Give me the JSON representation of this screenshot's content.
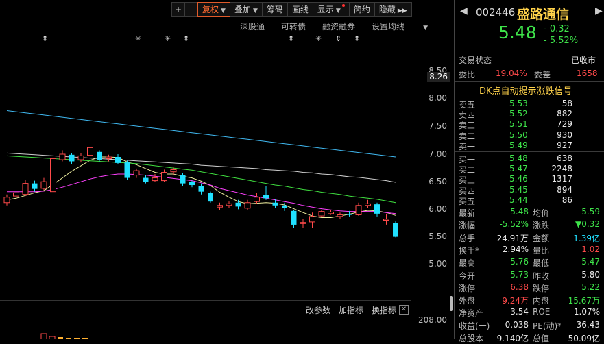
{
  "toolbar": {
    "plus": "+",
    "minus": "—",
    "fuquan": "复权",
    "diejia": "叠加",
    "chouma": "筹码",
    "huaxian": "画线",
    "xianshi": "显示",
    "jianyue": "简约",
    "yincang": "隐藏",
    "more": "▶▶"
  },
  "subbar": {
    "shengutong": "深股通",
    "kezhuanzhai": "可转债",
    "rongzirongquan": "融资融券",
    "shezhi_junxian": "设置均线"
  },
  "yaxis": {
    "labels": [
      "8.50",
      "8.00",
      "7.50",
      "7.00",
      "6.50",
      "6.00",
      "5.50",
      "5.00"
    ],
    "current": "8.26",
    "volume": "208.00"
  },
  "bottom_tabs": {
    "gaicanshu": "改参数",
    "jiazhibiao": "加指标",
    "huanzhibiao": "换指标"
  },
  "stock": {
    "code": "002446",
    "name": "盛路通信",
    "price": "5.48",
    "change": "- 0.32",
    "change_pct": "- 5.52%"
  },
  "status": {
    "label": "交易状态",
    "value": "已收市"
  },
  "weibi": {
    "label1": "委比",
    "value1": "19.04%",
    "label2": "委差",
    "value2": "1658"
  },
  "dk_signal": "DK点自动提示涨跌信号",
  "sells": [
    {
      "label": "卖五",
      "price": "5.53",
      "vol": "58"
    },
    {
      "label": "卖四",
      "price": "5.52",
      "vol": "882"
    },
    {
      "label": "卖三",
      "price": "5.51",
      "vol": "729"
    },
    {
      "label": "卖二",
      "price": "5.50",
      "vol": "930"
    },
    {
      "label": "卖一",
      "price": "5.49",
      "vol": "927"
    }
  ],
  "buys": [
    {
      "label": "买一",
      "price": "5.48",
      "vol": "638"
    },
    {
      "label": "买二",
      "price": "5.47",
      "vol": "2248"
    },
    {
      "label": "买三",
      "price": "5.46",
      "vol": "1317"
    },
    {
      "label": "买四",
      "price": "5.45",
      "vol": "894"
    },
    {
      "label": "买五",
      "price": "5.44",
      "vol": "86"
    }
  ],
  "stats": [
    {
      "l1": "最新",
      "v1": "5.48",
      "l2": "均价",
      "v2": "5.59"
    },
    {
      "l1": "涨幅",
      "v1": "-5.52%",
      "l2": "涨跌",
      "v2": "▼0.32"
    },
    {
      "l1": "总手",
      "v1": "24.91万",
      "l2": "金额",
      "v2": "1.39亿"
    },
    {
      "l1": "换手*",
      "v1": "2.94%",
      "l2": "量比",
      "v2": "1.02"
    },
    {
      "l1": "最高",
      "v1": "5.76",
      "l2": "最低",
      "v2": "5.47"
    },
    {
      "l1": "今开",
      "v1": "5.73",
      "l2": "昨收",
      "v2": "5.80"
    },
    {
      "l1": "涨停",
      "v1": "6.38",
      "l2": "跌停",
      "v2": "5.22"
    },
    {
      "l1": "外盘",
      "v1": "9.24万",
      "l2": "内盘",
      "v2": "15.67万"
    },
    {
      "l1": "净资产",
      "v1": "3.54",
      "l2": "ROE",
      "v2": "1.07%"
    },
    {
      "l1": "收益(一)",
      "v1": "0.038",
      "l2": "PE(动)*",
      "v2": "36.43"
    },
    {
      "l1": "总股本",
      "v1": "9.140亿",
      "l2": "总值",
      "v2": "50.09亿"
    }
  ],
  "colors": {
    "up": "#ff4a4a",
    "down": "#3ee34a",
    "cyan": "#20e0ff",
    "accent": "#ff6a30",
    "title_yellow": "#ffd24a"
  },
  "chart_data": {
    "type": "candlestick",
    "ylim": [
      4.8,
      8.6
    ],
    "candles": [
      {
        "o": 6.1,
        "c": 6.2,
        "h": 6.25,
        "l": 6.05
      },
      {
        "o": 6.22,
        "c": 6.28,
        "h": 6.32,
        "l": 6.18
      },
      {
        "o": 6.25,
        "c": 6.45,
        "h": 6.52,
        "l": 6.22
      },
      {
        "o": 6.45,
        "c": 6.35,
        "h": 6.5,
        "l": 6.3
      },
      {
        "o": 6.36,
        "c": 6.48,
        "h": 6.55,
        "l": 6.33
      },
      {
        "o": 6.3,
        "c": 6.9,
        "h": 7.02,
        "l": 6.28
      },
      {
        "o": 6.88,
        "c": 6.98,
        "h": 7.05,
        "l": 6.85
      },
      {
        "o": 6.97,
        "c": 6.85,
        "h": 7.0,
        "l": 6.8
      },
      {
        "o": 6.88,
        "c": 6.95,
        "h": 7.0,
        "l": 6.83
      },
      {
        "o": 6.96,
        "c": 7.1,
        "h": 7.15,
        "l": 6.92
      },
      {
        "o": 7.02,
        "c": 6.88,
        "h": 7.05,
        "l": 6.85
      },
      {
        "o": 6.9,
        "c": 6.93,
        "h": 6.97,
        "l": 6.85
      },
      {
        "o": 6.93,
        "c": 6.82,
        "h": 6.98,
        "l": 6.8
      },
      {
        "o": 6.83,
        "c": 6.55,
        "h": 6.86,
        "l": 6.52
      },
      {
        "o": 6.6,
        "c": 6.68,
        "h": 6.72,
        "l": 6.55
      },
      {
        "o": 6.55,
        "c": 6.47,
        "h": 6.6,
        "l": 6.45
      },
      {
        "o": 6.5,
        "c": 6.55,
        "h": 6.62,
        "l": 6.48
      },
      {
        "o": 6.5,
        "c": 6.65,
        "h": 6.7,
        "l": 6.48
      },
      {
        "o": 6.66,
        "c": 6.7,
        "h": 6.74,
        "l": 6.6
      },
      {
        "o": 6.6,
        "c": 6.45,
        "h": 6.64,
        "l": 6.4
      },
      {
        "o": 6.47,
        "c": 6.42,
        "h": 6.5,
        "l": 6.38
      },
      {
        "o": 6.4,
        "c": 6.3,
        "h": 6.45,
        "l": 6.25
      },
      {
        "o": 6.28,
        "c": 6.12,
        "h": 6.3,
        "l": 6.1
      },
      {
        "o": 6.02,
        "c": 6.05,
        "h": 6.1,
        "l": 5.97
      },
      {
        "o": 6.05,
        "c": 6.08,
        "h": 6.12,
        "l": 6.01
      },
      {
        "o": 6.1,
        "c": 6.03,
        "h": 6.15,
        "l": 5.98
      },
      {
        "o": 6.0,
        "c": 6.1,
        "h": 6.15,
        "l": 5.97
      },
      {
        "o": 6.12,
        "c": 6.2,
        "h": 6.28,
        "l": 6.08
      },
      {
        "o": 6.24,
        "c": 6.18,
        "h": 6.4,
        "l": 6.15
      },
      {
        "o": 6.1,
        "c": 6.05,
        "h": 6.16,
        "l": 6.0
      },
      {
        "o": 6.05,
        "c": 6.0,
        "h": 6.1,
        "l": 5.95
      },
      {
        "o": 5.95,
        "c": 5.7,
        "h": 5.97,
        "l": 5.65
      },
      {
        "o": 5.72,
        "c": 5.74,
        "h": 5.8,
        "l": 5.65
      },
      {
        "o": 5.75,
        "c": 5.85,
        "h": 5.92,
        "l": 5.65
      },
      {
        "o": 5.86,
        "c": 5.94,
        "h": 5.97,
        "l": 5.84
      },
      {
        "o": 5.9,
        "c": 5.93,
        "h": 5.96,
        "l": 5.88
      },
      {
        "o": 5.85,
        "c": 5.88,
        "h": 5.92,
        "l": 5.8
      },
      {
        "o": 5.89,
        "c": 5.88,
        "h": 5.95,
        "l": 5.85
      },
      {
        "o": 5.88,
        "c": 6.05,
        "h": 6.1,
        "l": 5.86
      },
      {
        "o": 6.05,
        "c": 6.08,
        "h": 6.15,
        "l": 6.0
      },
      {
        "o": 6.07,
        "c": 5.9,
        "h": 6.1,
        "l": 5.85
      },
      {
        "o": 5.78,
        "c": 5.8,
        "h": 5.9,
        "l": 5.7
      },
      {
        "o": 5.73,
        "c": 5.48,
        "h": 5.76,
        "l": 5.47
      }
    ],
    "ma": [
      {
        "name": "MA5",
        "color": "#f0f0a0",
        "values": [
          6.15,
          6.18,
          6.23,
          6.28,
          6.32,
          6.43,
          6.55,
          6.67,
          6.77,
          6.87,
          6.93,
          6.93,
          6.92,
          6.84,
          6.79,
          6.72,
          6.65,
          6.62,
          6.62,
          6.58,
          6.55,
          6.49,
          6.41,
          6.29,
          6.2,
          6.12,
          6.08,
          6.09,
          6.1,
          6.09,
          6.06,
          5.99,
          5.92,
          5.86,
          5.83,
          5.83,
          5.86,
          5.89,
          5.93,
          5.96,
          5.95,
          5.92,
          5.87
        ]
      },
      {
        "name": "MA10",
        "color": "#ff40ff",
        "values": [
          6.3,
          6.3,
          6.3,
          6.3,
          6.31,
          6.34,
          6.38,
          6.43,
          6.48,
          6.53,
          6.57,
          6.6,
          6.62,
          6.62,
          6.61,
          6.6,
          6.58,
          6.56,
          6.54,
          6.52,
          6.5,
          6.46,
          6.42,
          6.36,
          6.32,
          6.28,
          6.24,
          6.21,
          6.18,
          6.15,
          6.12,
          6.09,
          6.05,
          6.02,
          5.99,
          5.97,
          5.95,
          5.94,
          5.94,
          5.94,
          5.94,
          5.92,
          5.9
        ]
      },
      {
        "name": "MA20",
        "color": "#40e040",
        "values": [
          6.95,
          6.94,
          6.93,
          6.92,
          6.91,
          6.9,
          6.89,
          6.88,
          6.87,
          6.86,
          6.85,
          6.84,
          6.83,
          6.82,
          6.81,
          6.79,
          6.77,
          6.75,
          6.73,
          6.71,
          6.69,
          6.66,
          6.63,
          6.6,
          6.57,
          6.54,
          6.51,
          6.48,
          6.45,
          6.42,
          6.4,
          6.37,
          6.34,
          6.32,
          6.29,
          6.27,
          6.25,
          6.22,
          6.2,
          6.18,
          6.16,
          6.13,
          6.1
        ]
      },
      {
        "name": "MA30",
        "color": "#d0d0d0",
        "values": [
          7.0,
          6.99,
          6.98,
          6.97,
          6.96,
          6.95,
          6.94,
          6.93,
          6.92,
          6.91,
          6.9,
          6.89,
          6.88,
          6.87,
          6.86,
          6.85,
          6.84,
          6.83,
          6.82,
          6.81,
          6.8,
          6.78,
          6.77,
          6.76,
          6.75,
          6.74,
          6.73,
          6.72,
          6.7,
          6.69,
          6.68,
          6.67,
          6.65,
          6.64,
          6.62,
          6.61,
          6.59,
          6.57,
          6.56,
          6.54,
          6.52,
          6.5,
          6.47
        ]
      },
      {
        "name": "MA60",
        "color": "#40b8f0",
        "values": [
          7.77,
          7.75,
          7.73,
          7.71,
          7.69,
          7.67,
          7.65,
          7.63,
          7.61,
          7.59,
          7.57,
          7.55,
          7.53,
          7.51,
          7.49,
          7.47,
          7.45,
          7.43,
          7.41,
          7.39,
          7.37,
          7.35,
          7.33,
          7.31,
          7.29,
          7.27,
          7.25,
          7.23,
          7.21,
          7.19,
          7.17,
          7.15,
          7.13,
          7.11,
          7.09,
          7.07,
          7.05,
          7.03,
          7.01,
          6.99,
          6.97,
          6.95,
          6.93
        ]
      }
    ]
  }
}
